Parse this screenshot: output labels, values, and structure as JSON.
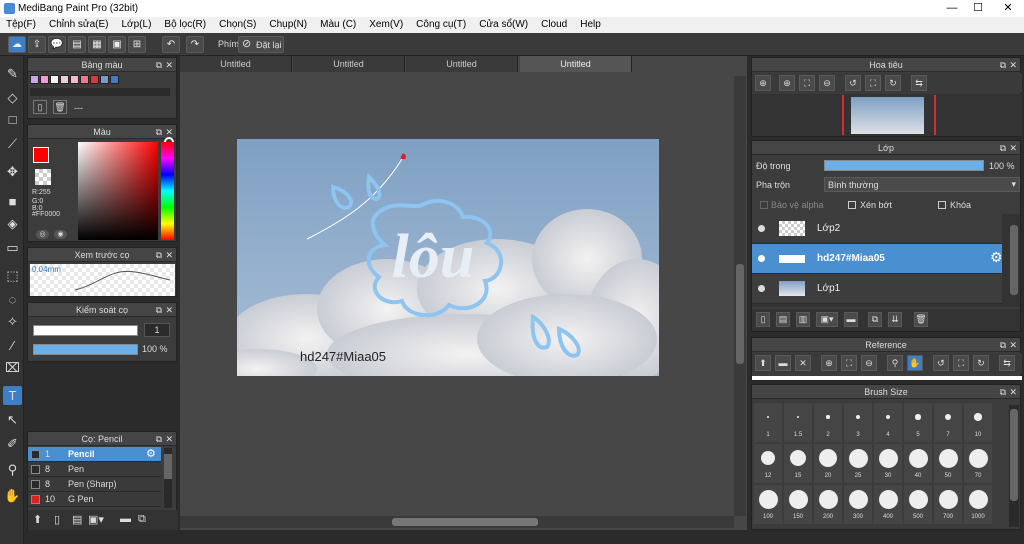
{
  "app": {
    "title": "MediBang Paint Pro (32bit)",
    "colors": {
      "accent": "#3d7fc4",
      "panel": "#3c3c3c",
      "bg": "#2b2b2b"
    }
  },
  "menu": [
    "Tệp(F)",
    "Chỉnh sửa(E)",
    "Lớp(L)",
    "Bộ lọc(R)",
    "Chọn(S)",
    "Chụp(N)",
    "Màu (C)",
    "Xem(V)",
    "Công cụ(T)",
    "Cửa sổ(W)",
    "Cloud",
    "Help"
  ],
  "toolbar": {
    "phim_label": "Phím",
    "reset_label": "Đặt lại"
  },
  "palette": {
    "title": "Bảng màu",
    "name": "---",
    "swatches": [
      "#c9a8e8",
      "#ef9ad6",
      "#f4f4f4",
      "#e8cfe0",
      "#f7b8c8",
      "#e87c8d",
      "#d43c3c",
      "#7a9ac9",
      "#4a78c8"
    ]
  },
  "color": {
    "title": "Màu",
    "r": "R:255",
    "g": "G:0",
    "b": "B:0",
    "hex": "#FF0000"
  },
  "brush_preview": {
    "title": "Xem trước cọ",
    "size": "0.04mm"
  },
  "brush_control": {
    "title": "Kiểm soát cọ",
    "size_value": "1",
    "opacity_value": "100 %"
  },
  "brush_list": {
    "title": "Cọ: Pencil",
    "items": [
      {
        "size": "1",
        "name": "Pencil",
        "color": "#2a2a2a"
      },
      {
        "size": "8",
        "name": "Pen",
        "color": "#2a2a2a"
      },
      {
        "size": "8",
        "name": "Pen (Sharp)",
        "color": "#2a2a2a"
      },
      {
        "size": "10",
        "name": "G Pen",
        "color": "#e02020"
      }
    ]
  },
  "tabs": [
    "Untitled",
    "Untitled",
    "Untitled",
    "Untitled"
  ],
  "canvas": {
    "logo_text": "lôu",
    "watermark": "hd247#Miaa05"
  },
  "navigator": {
    "title": "Hoa tiêu"
  },
  "layers": {
    "title": "Lớp",
    "opacity_label": "Độ trong",
    "opacity_value": "100 %",
    "blend_label": "Pha trộn",
    "blend_value": "Bình thường",
    "protect_alpha": "Bảo vệ alpha",
    "clipping": "Xén bớt",
    "lock": "Khóa",
    "items": [
      {
        "name": "Lớp2",
        "selected": false
      },
      {
        "name": "hd247#Miaa05",
        "selected": true
      },
      {
        "name": "Lớp1",
        "selected": false
      }
    ]
  },
  "reference": {
    "title": "Reference"
  },
  "brush_size": {
    "title": "Brush Size",
    "sizes": [
      "1",
      "1.5",
      "2",
      "3",
      "4",
      "5",
      "7",
      "10",
      "12",
      "15",
      "20",
      "25",
      "30",
      "40",
      "50",
      "70",
      "100",
      "150",
      "200",
      "300",
      "400",
      "500",
      "700",
      "1000"
    ]
  }
}
